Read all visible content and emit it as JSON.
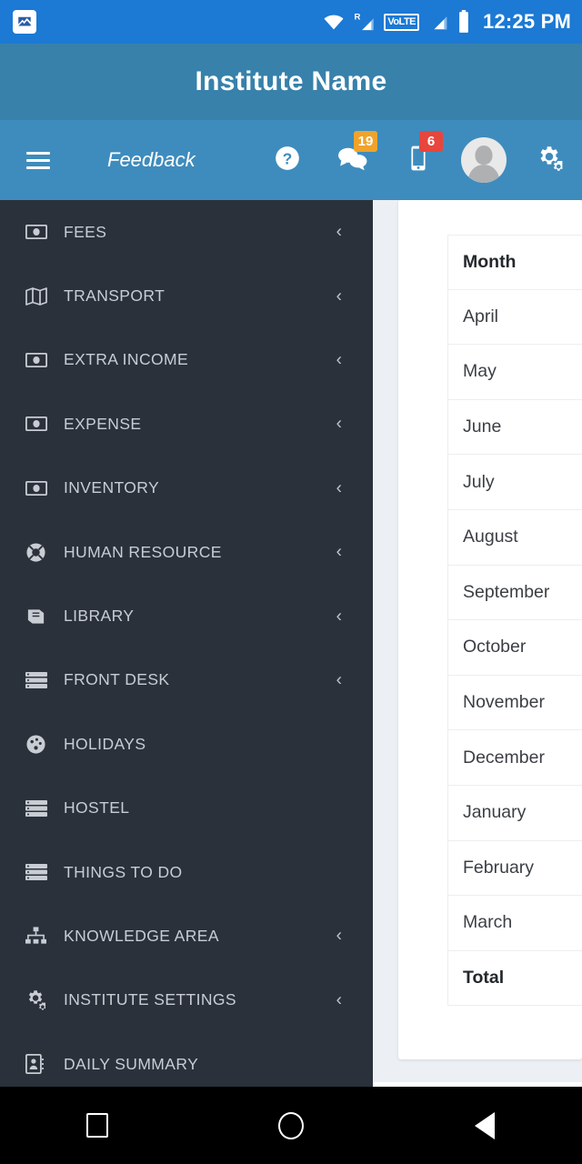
{
  "statusbar": {
    "notification_icon": "photo-icon",
    "icons": [
      "wifi-icon",
      "signal-roaming-icon",
      "volte-icon",
      "signal-icon",
      "battery-icon"
    ],
    "volte_label": "VoLTE",
    "roaming_label": "R",
    "time": "12:25 PM",
    "background_color": "#1c79d4"
  },
  "titlebar": {
    "title": "Institute Name",
    "background_color": "#3781ab"
  },
  "toolbar": {
    "background_color": "#3e8cbd",
    "menu_icon": "hamburger-icon",
    "feedback_label": "Feedback",
    "help_icon": "question-circle-icon",
    "messages_icon": "chat-bubbles-icon",
    "messages_badge": "19",
    "messages_badge_color": "#f0a32a",
    "device_icon": "mobile-phone-icon",
    "device_badge": "6",
    "device_badge_color": "#e8453c",
    "avatar_icon": "user-avatar",
    "settings_icon": "gears-icon"
  },
  "sidebar": {
    "background_color": "#2a313b",
    "text_color": "#c8cdd3",
    "items": [
      {
        "label": "FEES",
        "icon": "money-bill-icon",
        "chevron": true
      },
      {
        "label": "TRANSPORT",
        "icon": "map-icon",
        "chevron": true
      },
      {
        "label": "EXTRA INCOME",
        "icon": "money-bill-icon",
        "chevron": true
      },
      {
        "label": "EXPENSE",
        "icon": "money-bill-icon",
        "chevron": true
      },
      {
        "label": "INVENTORY",
        "icon": "money-bill-icon",
        "chevron": true
      },
      {
        "label": "HUMAN RESOURCE",
        "icon": "life-ring-icon",
        "chevron": true
      },
      {
        "label": "LIBRARY",
        "icon": "book-icon",
        "chevron": true
      },
      {
        "label": "FRONT DESK",
        "icon": "server-icon",
        "chevron": true
      },
      {
        "label": "HOLIDAYS",
        "icon": "dashboard-gauge-icon",
        "chevron": false
      },
      {
        "label": "HOSTEL",
        "icon": "server-icon",
        "chevron": false
      },
      {
        "label": "THINGS TO DO",
        "icon": "server-icon",
        "chevron": false
      },
      {
        "label": "KNOWLEDGE AREA",
        "icon": "sitemap-icon",
        "chevron": true
      },
      {
        "label": "INSTITUTE SETTINGS",
        "icon": "gears-icon",
        "chevron": true
      },
      {
        "label": "DAILY SUMMARY",
        "icon": "contact-card-icon",
        "chevron": false
      }
    ],
    "chevron_glyph": "‹"
  },
  "main": {
    "background_color": "#eceff4",
    "card_color": "#ffffff",
    "table": {
      "header": "Month",
      "rows": [
        "April",
        "May",
        "June",
        "July",
        "August",
        "September",
        "October",
        "November",
        "December",
        "January",
        "February",
        "March"
      ],
      "footer": "Total"
    }
  },
  "navbar": {
    "background_color": "#000000",
    "recents_icon": "square-recents-icon",
    "home_icon": "circle-home-icon",
    "back_icon": "triangle-back-icon"
  }
}
